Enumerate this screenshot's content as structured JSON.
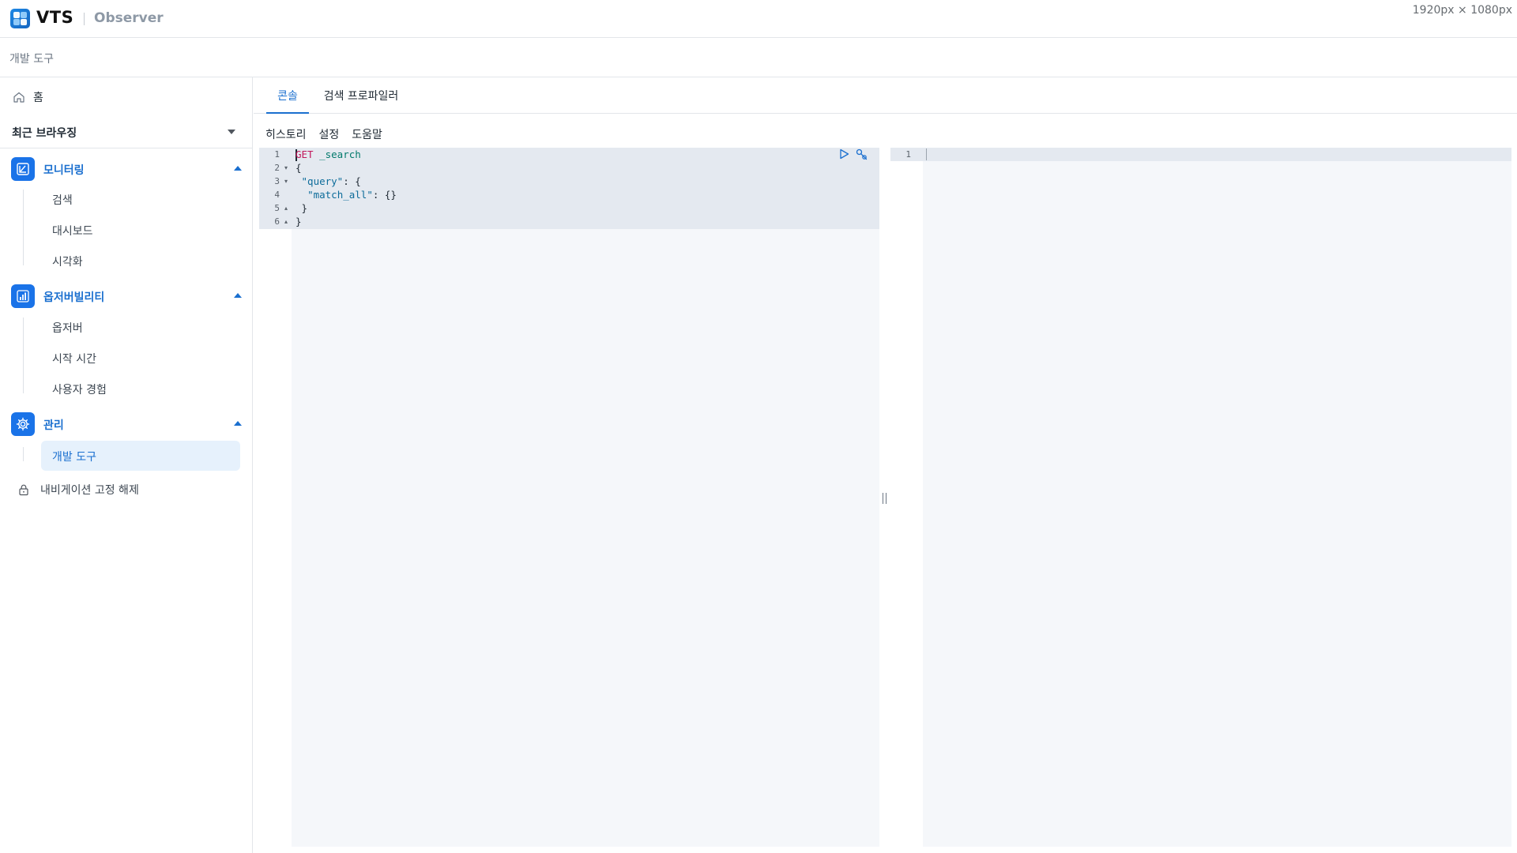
{
  "header": {
    "brand": "VTS",
    "product": "Observer",
    "viewport_label": "1920px × 1080px"
  },
  "breadcrumb": "개발 도구",
  "sidebar": {
    "home": "홈",
    "recent": "최근 브라우징",
    "groups": [
      {
        "label": "모니터링",
        "icon": "monitoring-icon",
        "items": [
          "검색",
          "대시보드",
          "시각화"
        ]
      },
      {
        "label": "옵저버빌리티",
        "icon": "bar-chart-icon",
        "items": [
          "옵저버",
          "시작 시간",
          "사용자 경험"
        ]
      },
      {
        "label": "관리",
        "icon": "gear-icon",
        "items": [
          "개발 도구"
        ]
      }
    ],
    "active_item": "개발 도구",
    "unpin": "내비게이션 고정 해제"
  },
  "tabs": [
    {
      "label": "콘솔",
      "active": true
    },
    {
      "label": "검색 프로파일러",
      "active": false
    }
  ],
  "toolbar": {
    "history": "히스토리",
    "settings": "설정",
    "help": "도움말"
  },
  "request_editor": {
    "lines": [
      {
        "num": "1",
        "text": "GET _search"
      },
      {
        "num": "2",
        "text": "{"
      },
      {
        "num": "3",
        "text": "  \"query\": {"
      },
      {
        "num": "4",
        "text": "    \"match_all\": {}"
      },
      {
        "num": "5",
        "text": "  }"
      },
      {
        "num": "6",
        "text": "}"
      }
    ],
    "tokens": {
      "method": "GET",
      "path": "_search",
      "open": "{",
      "query_key": "\"query\"",
      "match_all_key": "\"match_all\"",
      "colon_obj": ": {",
      "colon_empty": ": {}",
      "close_inner": "}",
      "close_outer": "}"
    }
  },
  "response_editor": {
    "lines": [
      {
        "num": "1",
        "text": ""
      }
    ]
  },
  "colors": {
    "accent": "#1a73e8",
    "active_bg": "#e6f1fc",
    "editor_bg": "#f5f7fa"
  }
}
